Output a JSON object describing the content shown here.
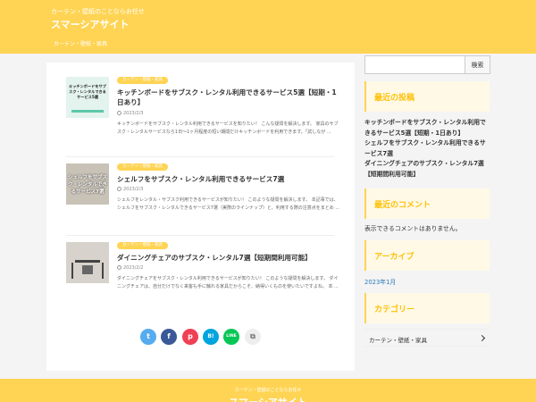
{
  "header": {
    "tagline": "カーテン・壁紙のことならお任せ",
    "site_title": "スマーシアサイト",
    "nav_item": "カーテン・壁紙・家具"
  },
  "entries": [
    {
      "category": "カーテン・壁紙・家具",
      "title": "キッチンボードをサブスク・レンタル利用できるサービス5選【短期・1日あり】",
      "date": "2023/2/3",
      "snippet": "キッチンボードをサブスク・レンタル利用できるサービスを知りたい！ こんな疑問を解決します。 家具のサブスク・レンタルサービスなら1日～1ヶ月程度の短い期間だけキッチンボードを利用できます。「試しなが ...",
      "thumb_text": "キッチンボードをサブスク・レンタルできるサービス5選"
    },
    {
      "category": "カーテン・壁紙・家具",
      "title": "シェルフをサブスク・レンタル利用できるサービス7選",
      "date": "2023/2/3",
      "snippet": "シェルフをレンタル・サブスク利用できるサービスが知りたい！ このような疑問を解決します。 本記事では、シェルフをサブスク・レンタルできるサービス7選（実際のラインナップ）と、利用する際の注意点をまとめ ...",
      "thumb_text": "シェルフをサブスク・レンタルできるサービス7選"
    },
    {
      "category": "カーテン・壁紙・家具",
      "title": "ダイニングチェアのサブスク・レンタル7選【短期間利用可能】",
      "date": "2023/2/2",
      "snippet": "ダイニングチェアをサブスク・レンタル利用できるサービスが知りたい！ このような疑問を解決します。 ダイニングチェアは、自分だけでなく来客も手に触れる家具だからこそ、納得いくものを使いたいですよね。 本 ..."
    }
  ],
  "share": {
    "twitter": "t",
    "facebook": "f",
    "pocket": "p",
    "hatena": "B!",
    "line": "LINE",
    "copy": "⧉"
  },
  "sidebar": {
    "search_placeholder": "",
    "search_button": "検索",
    "recent_posts_heading": "最近の投稿",
    "recent_posts": [
      "キッチンボードをサブスク・レンタル利用できるサービス5選【短期・1日あり】",
      "シェルフをサブスク・レンタル利用できるサービス7選",
      "ダイニングチェアのサブスク・レンタル7選【短期間利用可能】"
    ],
    "recent_comments_heading": "最近のコメント",
    "no_comments": "表示できるコメントはありません。",
    "archive_heading": "アーカイブ",
    "archive_link": "2023年1月",
    "category_heading": "カテゴリー",
    "category_item": "カーテン・壁紙・家具"
  },
  "footer": {
    "tagline": "カーテン・壁紙のことならお任せ",
    "site_title": "スマーシアサイト"
  },
  "colors": {
    "accent": "#ffd454",
    "heading_text": "#ffc107",
    "link": "#2b7bb9"
  }
}
